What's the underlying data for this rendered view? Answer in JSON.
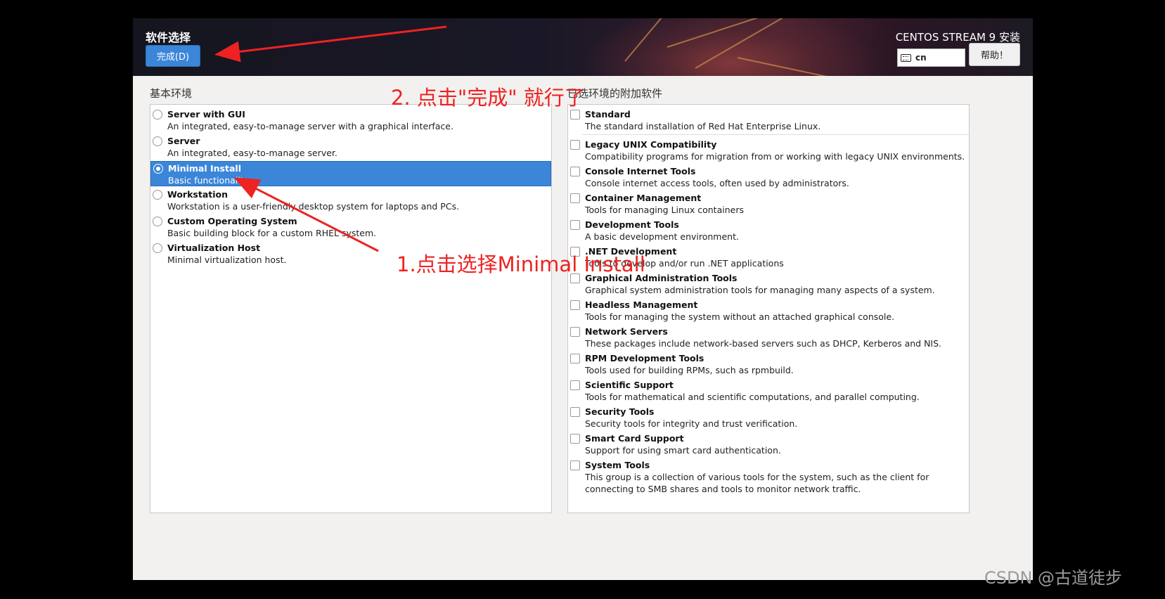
{
  "header": {
    "spoke_title": "软件选择",
    "done_button": "完成(D)",
    "product_title": "CENTOS STREAM 9 安装",
    "keyboard_layout": "cn",
    "help_button": "帮助！"
  },
  "base_env": {
    "label": "基本环境",
    "items": [
      {
        "name": "Server with GUI",
        "desc": "An integrated, easy-to-manage server with a graphical interface."
      },
      {
        "name": "Server",
        "desc": "An integrated, easy-to-manage server."
      },
      {
        "name": "Minimal Install",
        "desc": "Basic functionality."
      },
      {
        "name": "Workstation",
        "desc": "Workstation is a user-friendly desktop system for laptops and PCs."
      },
      {
        "name": "Custom Operating System",
        "desc": "Basic building block for a custom RHEL system."
      },
      {
        "name": "Virtualization Host",
        "desc": "Minimal virtualization host."
      }
    ],
    "selected": "Minimal Install"
  },
  "addons": {
    "label": "已选环境的附加软件",
    "items": [
      {
        "name": "Standard",
        "desc": "The standard installation of Red Hat Enterprise Linux."
      },
      {
        "name": "Legacy UNIX Compatibility",
        "desc": "Compatibility programs for migration from or working with legacy UNIX environments."
      },
      {
        "name": "Console Internet Tools",
        "desc": "Console internet access tools, often used by administrators."
      },
      {
        "name": "Container Management",
        "desc": "Tools for managing Linux containers"
      },
      {
        "name": "Development Tools",
        "desc": "A basic development environment."
      },
      {
        "name": ".NET Development",
        "desc": "Tools to develop and/or run .NET applications"
      },
      {
        "name": "Graphical Administration Tools",
        "desc": "Graphical system administration tools for managing many aspects of a system."
      },
      {
        "name": "Headless Management",
        "desc": "Tools for managing the system without an attached graphical console."
      },
      {
        "name": "Network Servers",
        "desc": "These packages include network-based servers such as DHCP, Kerberos and NIS."
      },
      {
        "name": "RPM Development Tools",
        "desc": "Tools used for building RPMs, such as rpmbuild."
      },
      {
        "name": "Scientific Support",
        "desc": "Tools for mathematical and scientific computations, and parallel computing."
      },
      {
        "name": "Security Tools",
        "desc": "Security tools for integrity and trust verification."
      },
      {
        "name": "Smart Card Support",
        "desc": "Support for using smart card authentication."
      },
      {
        "name": "System Tools",
        "desc": "This group is a collection of various tools for the system, such as the client for connecting to SMB shares and tools to monitor network traffic."
      }
    ]
  },
  "annotations": {
    "step2": "2. 点击\"完成\" 就行了",
    "step1": "1.点击选择Minimal Install",
    "arrow_color": "#ee2222"
  },
  "watermark": "CSDN @古道徒步",
  "colors": {
    "accent": "#3b86d8",
    "panel_bg": "#f2f1f0"
  }
}
